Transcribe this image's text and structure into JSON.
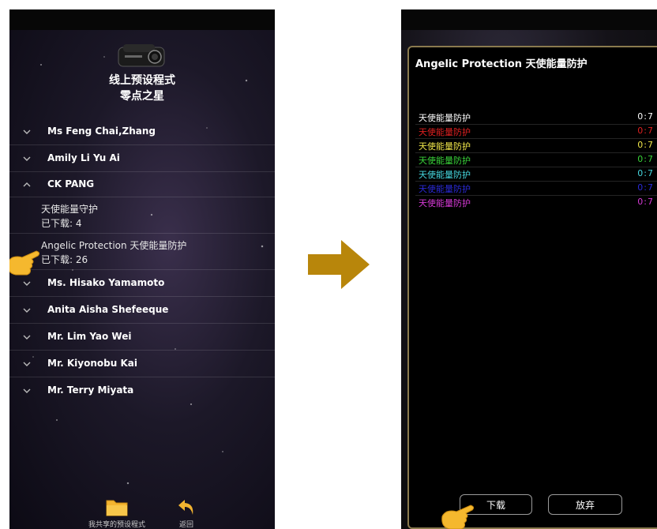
{
  "left_screen": {
    "title_line1": "线上预设程式",
    "title_line2": "零点之星",
    "groups": [
      {
        "name": "Ms Feng Chai,Zhang",
        "expanded": false
      },
      {
        "name": "Amily Li Yu Ai",
        "expanded": false
      },
      {
        "name": "CK PANG",
        "expanded": true
      }
    ],
    "sub_items": [
      {
        "title": "天使能量守护",
        "downloads": "已下载: 4"
      },
      {
        "title": "Angelic Protection 天使能量防护",
        "downloads": "已下载: 26"
      }
    ],
    "more_groups": [
      {
        "name": "Ms. Hisako Yamamoto"
      },
      {
        "name": "Anita Aisha Shefeeque"
      },
      {
        "name": "Mr. Lim Yao Wei"
      },
      {
        "name": "Mr. Kiyonobu Kai"
      },
      {
        "name": "Mr. Terry Miyata"
      }
    ],
    "bottom_bar": {
      "shared_label": "我共享的预设程式",
      "back_label": "返回"
    }
  },
  "right_screen": {
    "dialog_title": "Angelic Protection 天使能量防护",
    "programs": [
      {
        "name": "天使能量防护",
        "value": "0:7",
        "color": "#ffffff"
      },
      {
        "name": "天使能量防护",
        "value": "0:7",
        "color": "#e02020"
      },
      {
        "name": "天使能量防护",
        "value": "0:7",
        "color": "#f2e84a"
      },
      {
        "name": "天使能量防护",
        "value": "0:7",
        "color": "#3ad43a"
      },
      {
        "name": "天使能量防护",
        "value": "0:7",
        "color": "#46d8e0"
      },
      {
        "name": "天使能量防护",
        "value": "0:7",
        "color": "#2a2ad8"
      },
      {
        "name": "天使能量防护",
        "value": "0:7",
        "color": "#d83ad8"
      }
    ],
    "download_button": "下载",
    "cancel_button": "放弃"
  },
  "colors": {
    "accent_gold": "#b8860b",
    "hand_yellow": "#f5b82e",
    "folder_yellow": "#f2b430",
    "dialog_border": "#8a7a4e"
  },
  "icons": [
    "projector-icon",
    "chevron-down-icon",
    "chevron-up-icon",
    "pointing-hand-icon",
    "folder-icon",
    "back-arrow-icon",
    "right-arrow-icon"
  ]
}
